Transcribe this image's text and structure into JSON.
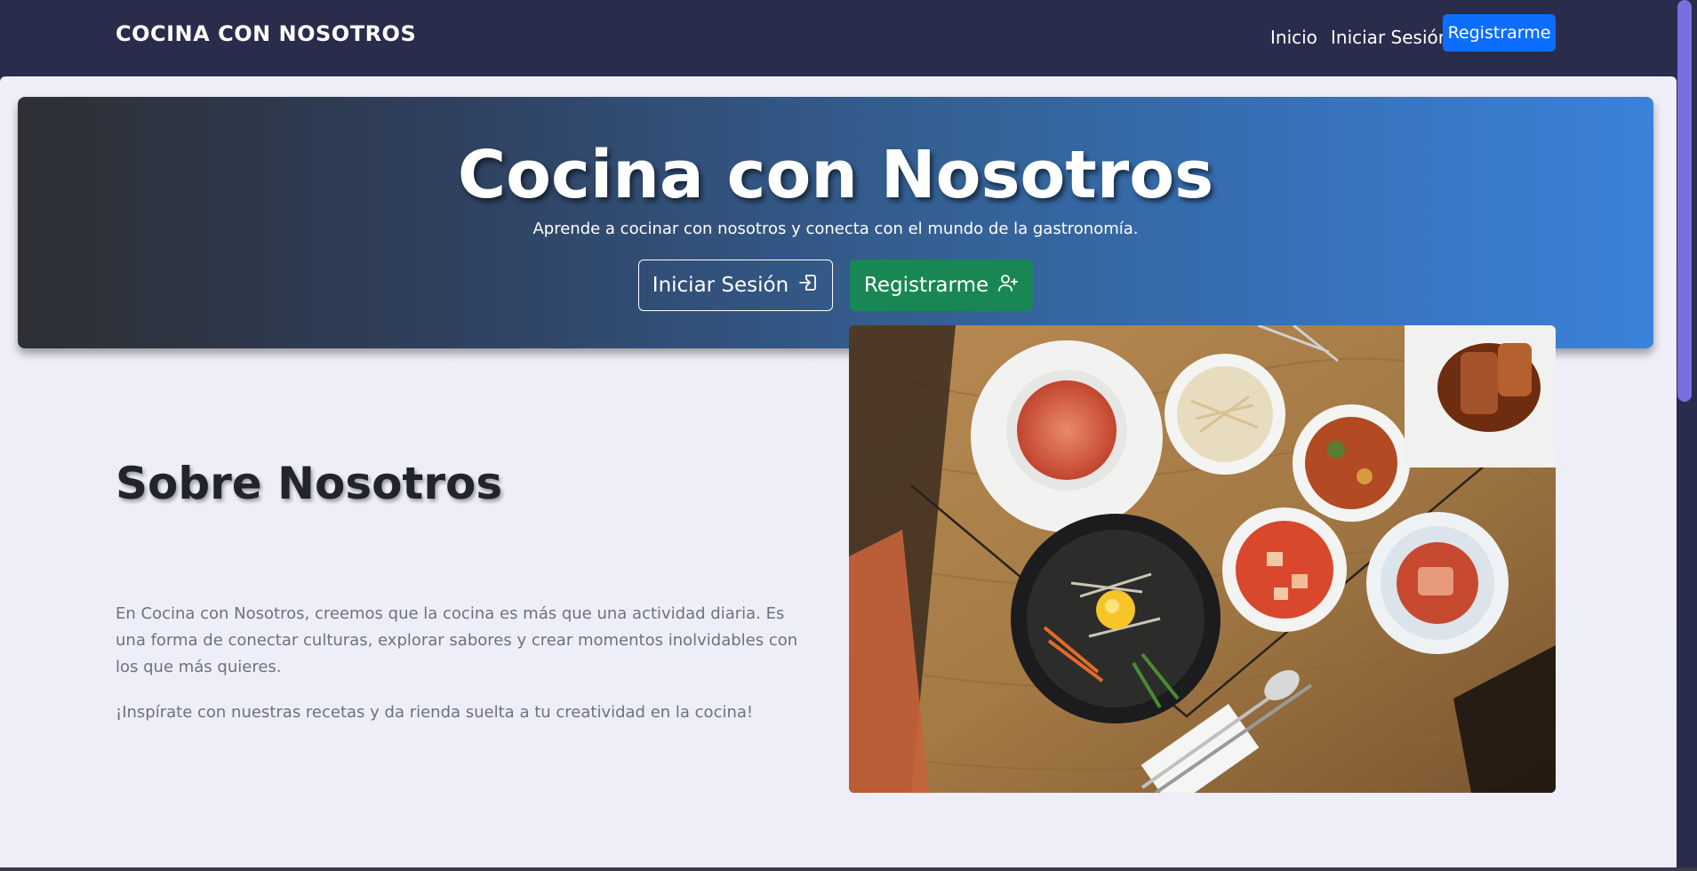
{
  "navbar": {
    "brand": "COCINA CON NOSOTROS",
    "links": [
      "Inicio",
      "Iniciar Sesión"
    ],
    "register_button": "Registrarme"
  },
  "hero": {
    "title": "Cocina con Nosotros",
    "subtitle": "Aprende a cocinar con nosotros y conecta con el mundo de la gastronomía.",
    "login_button": "Iniciar Sesión",
    "register_button": "Registrarme",
    "login_icon": "box-arrow-in-right-icon",
    "register_icon": "person-plus-icon"
  },
  "about": {
    "title": "Sobre Nosotros",
    "paragraph1": "En Cocina con Nosotros, creemos que la cocina es más que una actividad diaria. Es una forma de conectar culturas, explorar sabores y crear momentos inolvidables con los que más quieres.",
    "paragraph2": "¡Inspírate con nuestras recetas y da rienda suelta a tu creatividad en la cocina!"
  },
  "colors": {
    "navbar_bg": "#2a2c4c",
    "primary": "#0d6efd",
    "success": "#198754",
    "hero_gradient_start": "#2d2f33",
    "hero_gradient_end": "#3a82da"
  }
}
